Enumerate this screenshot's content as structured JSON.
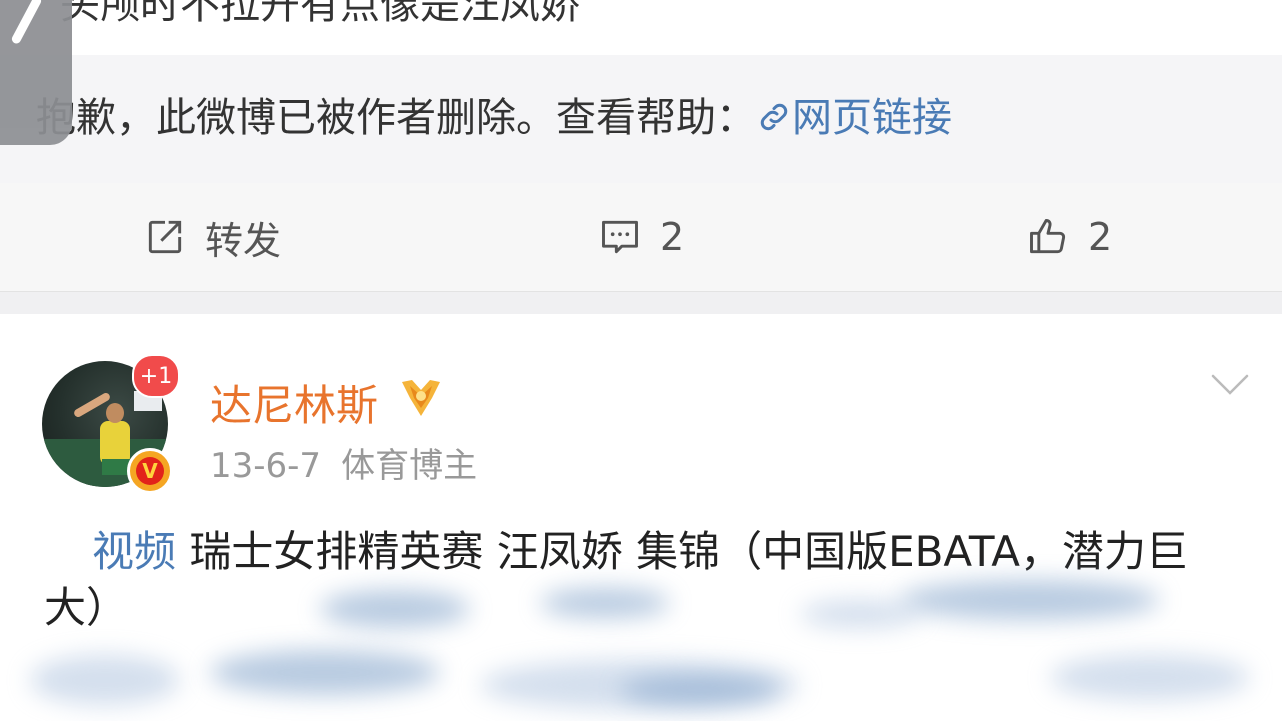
{
  "top_strip": {
    "cut_text": "头颅时不拉开有点像是汪凤娇"
  },
  "deleted_notice": {
    "message": "抱歉，此微博已被作者删除。查看帮助：",
    "link_label": "网页链接"
  },
  "actions": {
    "repost_label": "转发",
    "comment_count": "2",
    "like_count": "2"
  },
  "post": {
    "username": "达尼林斯",
    "avatar_badge": "+1",
    "verified_badge": "V",
    "date": "13-6-7",
    "category": "体育博主",
    "video_tag": "视频",
    "text": "瑞士女排精英赛 汪凤娇 集锦（中国版EBATA，潜力巨大）"
  },
  "colors": {
    "username": "#e8742d",
    "link": "#4a7bb5",
    "meta": "#999999",
    "badge_red": "#f14b4b"
  },
  "icons": [
    "back-icon",
    "link-icon",
    "repost-icon",
    "comment-icon",
    "like-icon",
    "medal-icon",
    "chevron-down-icon",
    "verified-icon"
  ]
}
